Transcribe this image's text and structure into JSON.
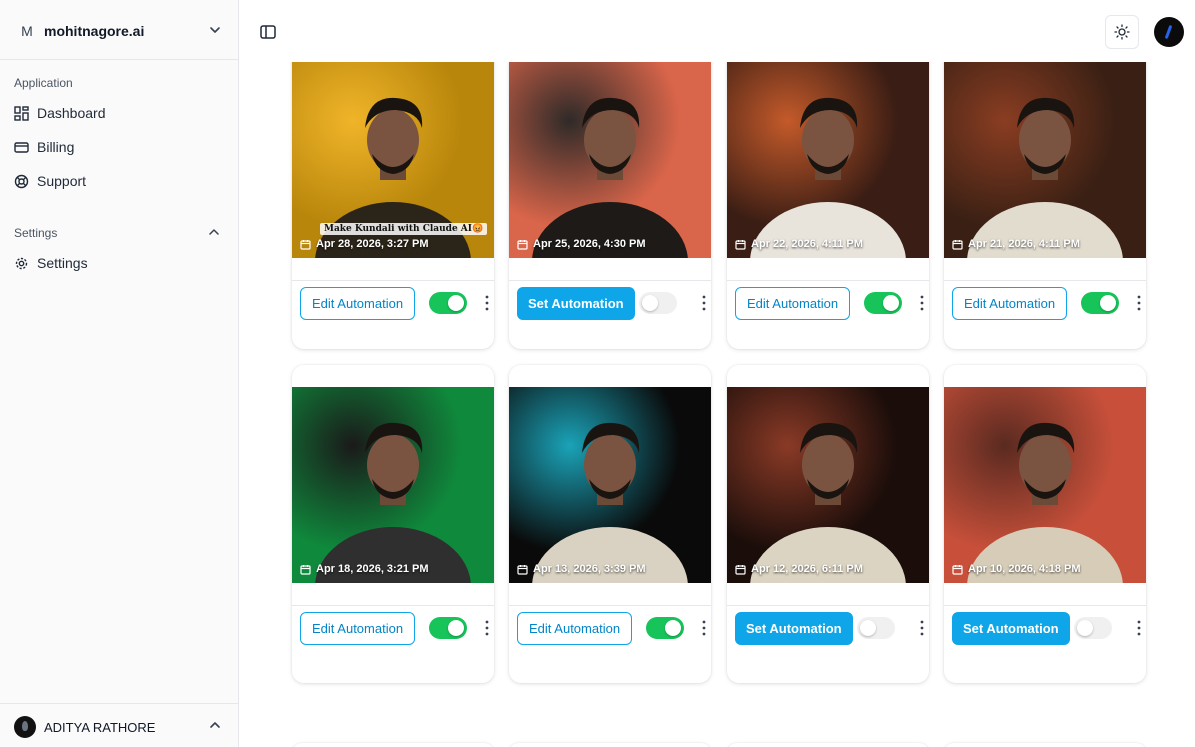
{
  "workspace": {
    "initial": "M",
    "name": "mohitnagore.ai"
  },
  "sidebar": {
    "application_label": "Application",
    "settings_label": "Settings",
    "items": [
      {
        "label": "Dashboard",
        "icon": "dashboard-icon"
      },
      {
        "label": "Billing",
        "icon": "credit-card-icon"
      },
      {
        "label": "Support",
        "icon": "lifebuoy-icon"
      }
    ],
    "settings_items": [
      {
        "label": "Settings",
        "icon": "gear-icon"
      }
    ]
  },
  "user": {
    "name": "ADITYA RATHORE"
  },
  "posts": [
    {
      "date": "Apr 28, 2026, 3:27 PM",
      "caption": "Make Kundali with Claude AI😡",
      "button": "Edit Automation",
      "button_type": "edit",
      "enabled": true,
      "colors": [
        "#b8860b",
        "#f0b429",
        "#2b2418"
      ]
    },
    {
      "date": "Apr 25, 2026, 4:30 PM",
      "caption": "",
      "button": "Set Automation",
      "button_type": "set",
      "enabled": false,
      "colors": [
        "#d9654a",
        "#2f2a28",
        "#1e1a18"
      ]
    },
    {
      "date": "Apr 22, 2026, 4:11 PM",
      "caption": "",
      "button": "Edit Automation",
      "button_type": "edit",
      "enabled": true,
      "colors": [
        "#3a1d14",
        "#c45a2a",
        "#e8e4dc"
      ]
    },
    {
      "date": "Apr 21, 2026, 4:11 PM",
      "caption": "",
      "button": "Edit Automation",
      "button_type": "edit",
      "enabled": true,
      "colors": [
        "#3a2014",
        "#8a3d22",
        "#e2dccf"
      ]
    },
    {
      "date": "Apr 18, 2026, 3:21 PM",
      "caption": "",
      "button": "Edit Automation",
      "button_type": "edit",
      "enabled": true,
      "colors": [
        "#0f8a3c",
        "#1a1a1a",
        "#2f2f2f"
      ]
    },
    {
      "date": "Apr 13, 2026, 3:39 PM",
      "caption": "",
      "button": "Edit Automation",
      "button_type": "edit",
      "enabled": true,
      "colors": [
        "#0a0a0a",
        "#1aa3b8",
        "#d9d2c2"
      ]
    },
    {
      "date": "Apr 12, 2026, 6:11 PM",
      "caption": "",
      "button": "Set Automation",
      "button_type": "set",
      "enabled": false,
      "colors": [
        "#1a0d0a",
        "#8a3a26",
        "#dcd4c2"
      ]
    },
    {
      "date": "Apr 10, 2026, 4:18 PM",
      "caption": "",
      "button": "Set Automation",
      "button_type": "set",
      "enabled": false,
      "colors": [
        "#c8503a",
        "#5a2a20",
        "#d6ccb8"
      ]
    }
  ],
  "colors": {
    "accent": "#0ea5e9",
    "toggle_on": "#16c45a"
  }
}
